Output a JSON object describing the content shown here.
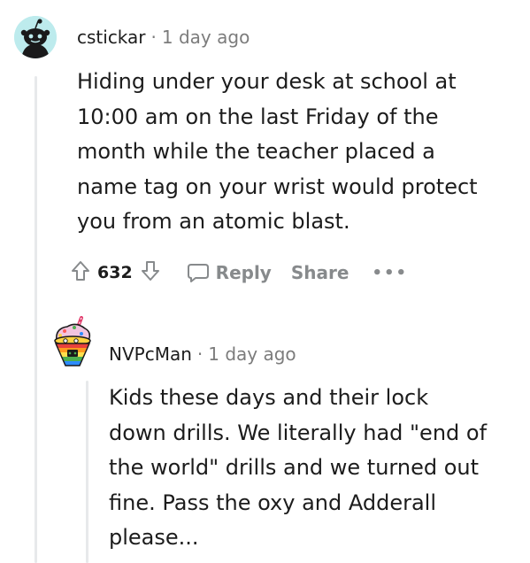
{
  "comments": [
    {
      "username": "cstickar",
      "separator": "·",
      "time": "1 day ago",
      "body_lines": [
        "Hiding under your desk at school at",
        "10:00 am on the last Friday of the",
        "month while the teacher placed a",
        "name tag on your wrist would protect",
        "you from an atomic blast."
      ],
      "score": "632",
      "actions": {
        "reply": "Reply",
        "share": "Share",
        "more": "•••"
      },
      "avatar_icon": "snoo-avatar-icon"
    },
    {
      "username": "NVPcMan",
      "separator": "·",
      "time": "1 day ago",
      "body_lines": [
        "Kids these days and their lock",
        "down drills. We literally had \"end of",
        "the world\" drills and we turned out",
        "fine. Pass the oxy and Adderall",
        "please..."
      ],
      "avatar_icon": "nft-cupcake-avatar-icon"
    }
  ],
  "colors": {
    "text": "#1c1c1c",
    "meta": "#7c7c7c",
    "action": "#878a8c",
    "thread_line": "#e7e9eb",
    "avatar_bg": "#bdebed"
  }
}
